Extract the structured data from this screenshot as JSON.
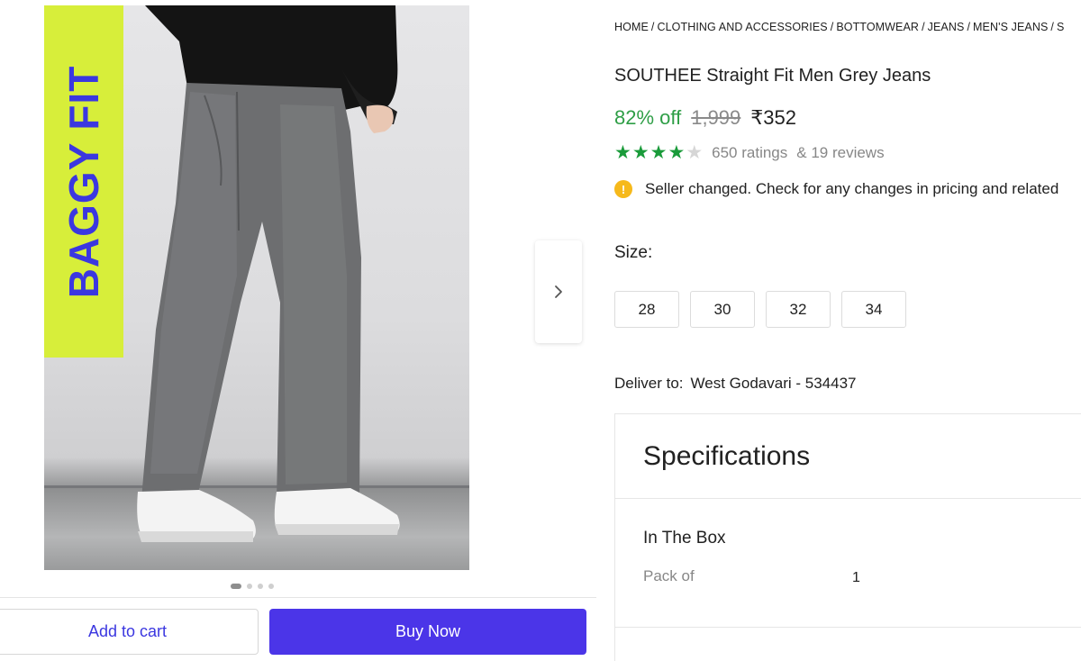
{
  "gallery": {
    "banner_text": "BAGGY FIT",
    "dot_count": 4,
    "active_dot": 0,
    "next_icon": "chevron-right-icon"
  },
  "actions": {
    "add_to_cart": "Add to cart",
    "buy_now": "Buy Now"
  },
  "breadcrumb": [
    "HOME",
    "CLOTHING AND ACCESSORIES",
    "BOTTOMWEAR",
    "JEANS",
    "MEN'S JEANS",
    "S"
  ],
  "product": {
    "title": "SOUTHEE Straight Fit Men Grey Jeans",
    "discount": "82% off",
    "mrp": "1,999",
    "price": "₹352",
    "rating_value": 4,
    "rating_max": 5,
    "ratings": "650 ratings",
    "reviews": "& 19 reviews",
    "notice": "Seller changed. Check for any changes in pricing and related"
  },
  "size": {
    "label": "Size:",
    "options": [
      "28",
      "30",
      "32",
      "34"
    ]
  },
  "delivery": {
    "label": "Deliver to:",
    "location": "West Godavari - 534437"
  },
  "specifications": {
    "title": "Specifications",
    "section": "In The Box",
    "rows": [
      {
        "key": "Pack of",
        "value": "1"
      }
    ]
  },
  "colors": {
    "accent": "#4b35e8",
    "discount_green": "#2e9e46",
    "star_green": "#1a9b3a",
    "banner_bg": "#d7ee3a",
    "banner_text": "#3b37e0",
    "info_yellow": "#f6b91b"
  }
}
